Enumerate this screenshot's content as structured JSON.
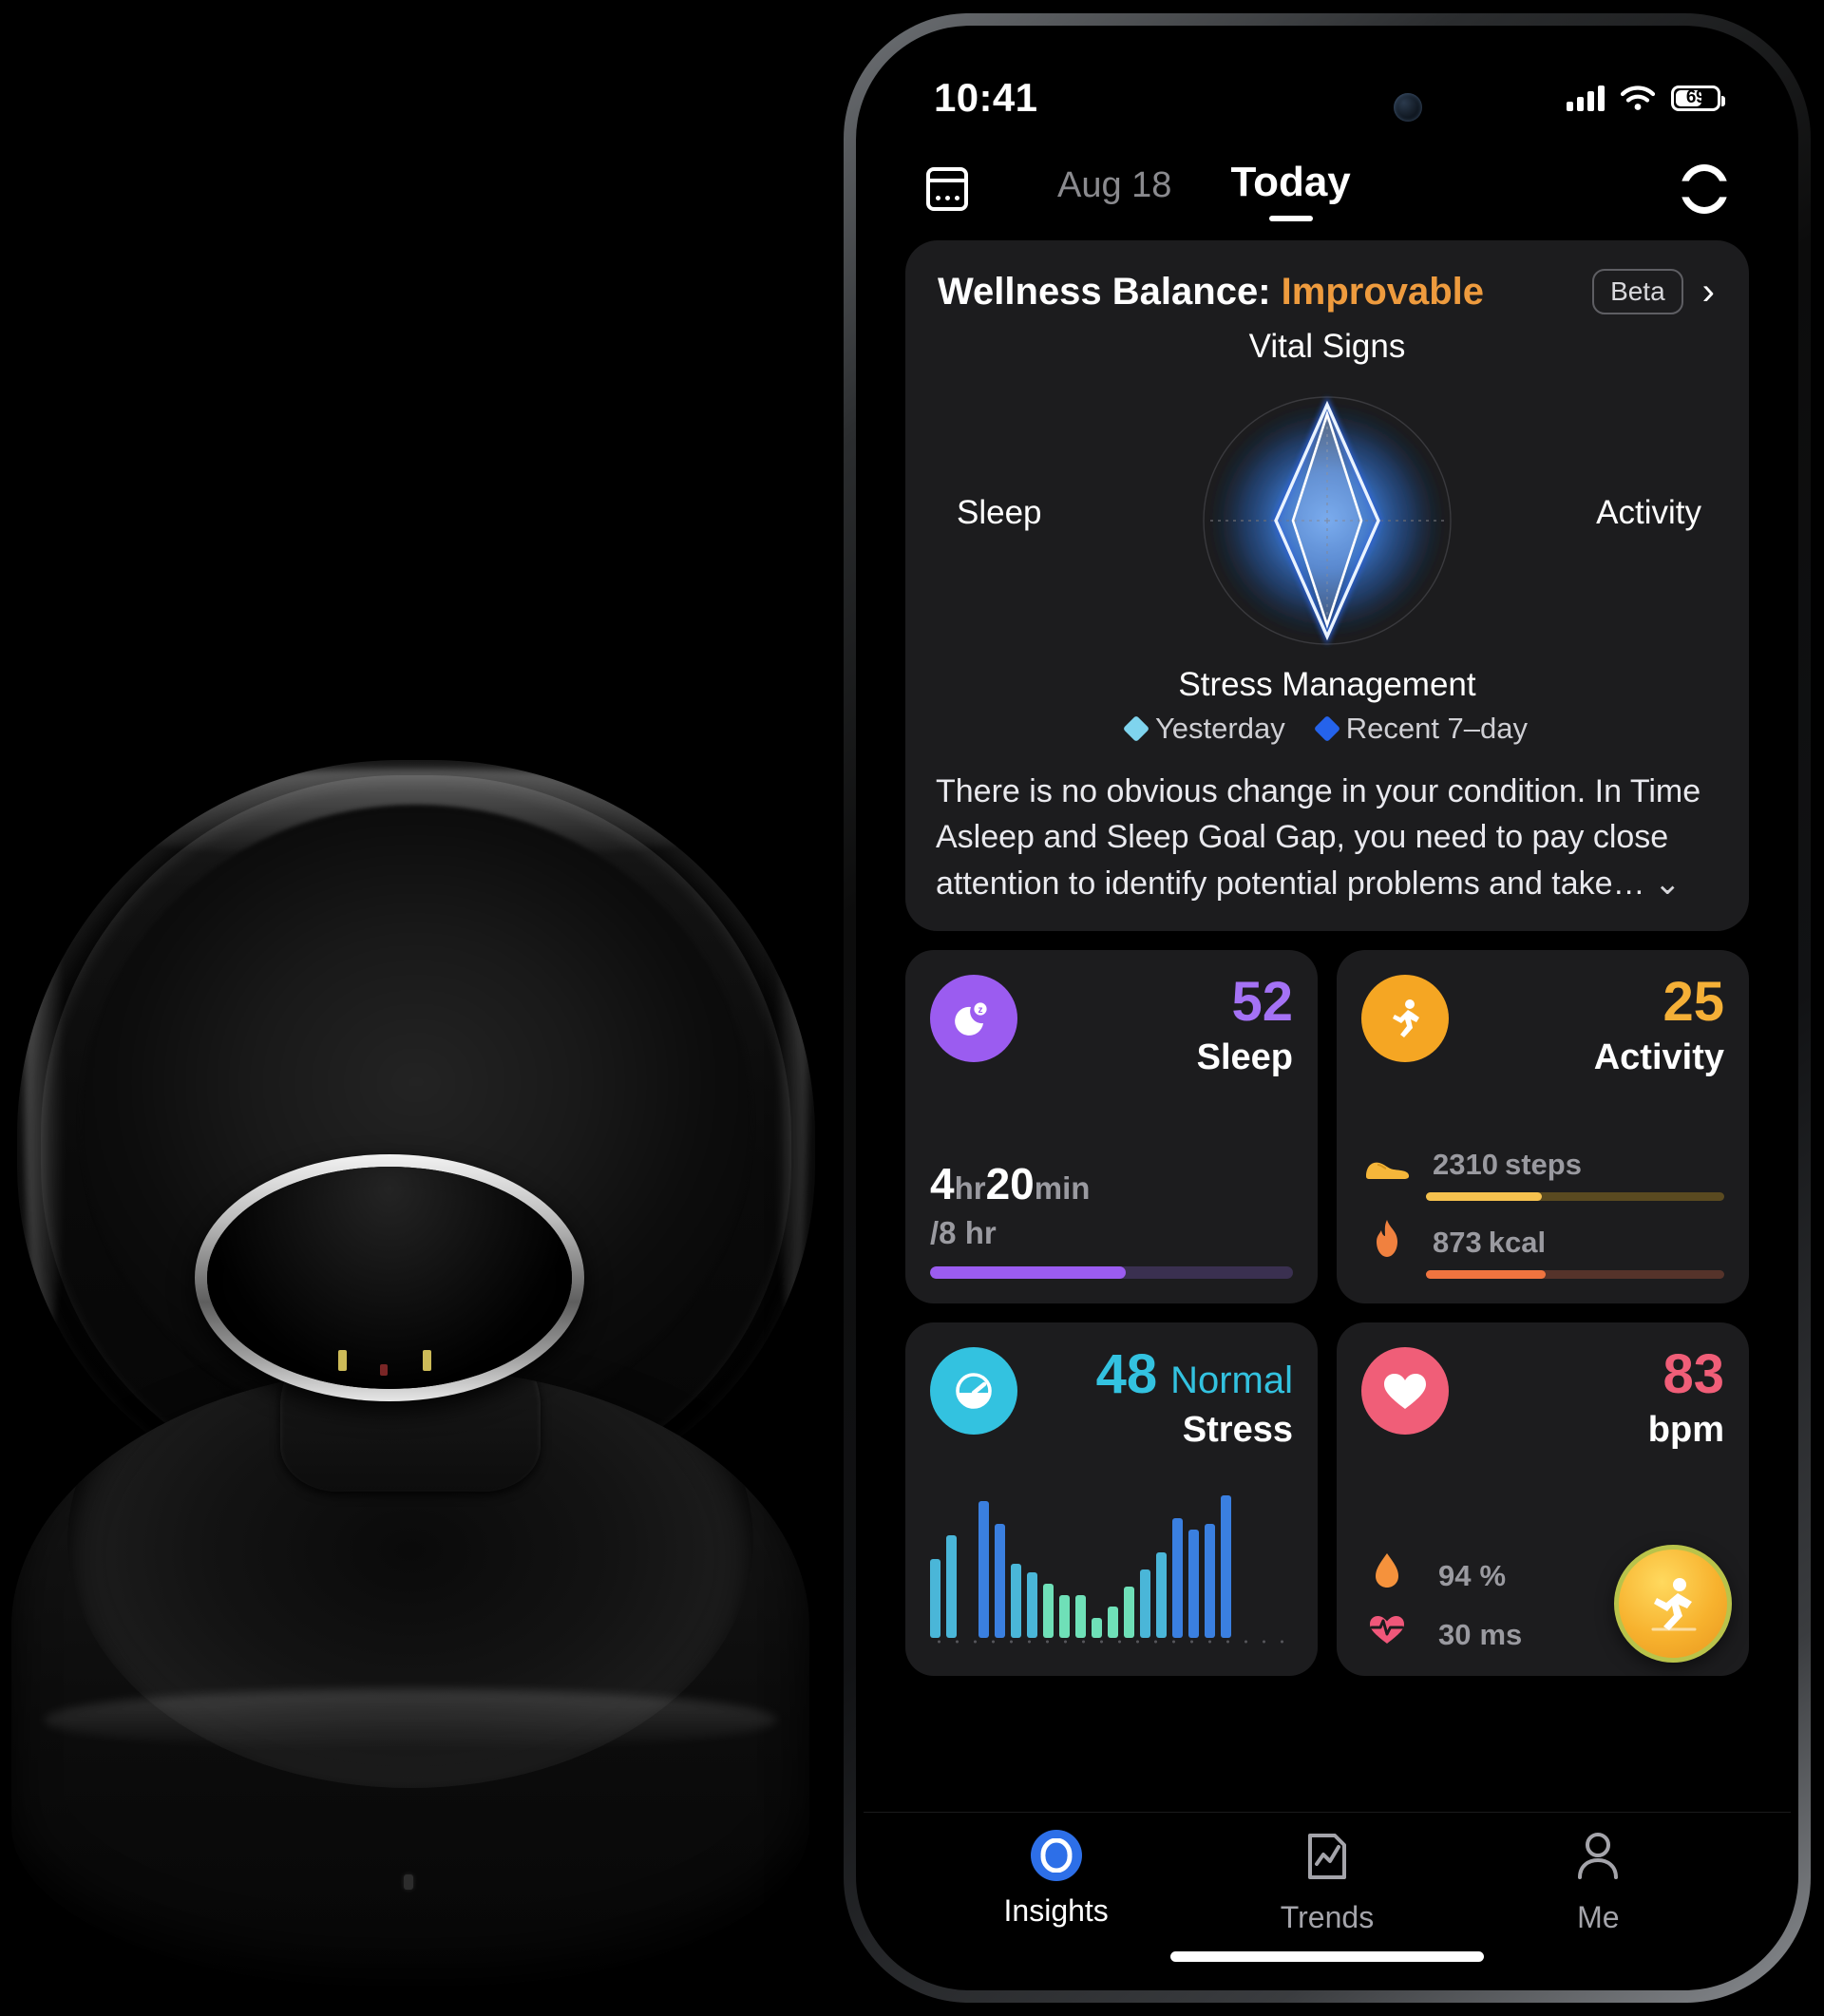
{
  "product": {
    "name": "smart-ring-with-charging-case",
    "description": "Black smart ring resting in its open black charging case"
  },
  "status_bar": {
    "time": "10:41",
    "battery_percent": "69",
    "signal_icon": "cellular-signal-icon",
    "wifi_icon": "wifi-icon",
    "battery_icon": "battery-icon"
  },
  "nav": {
    "calendar_icon": "calendar-icon",
    "previous_date": "Aug 18",
    "current_date": "Today",
    "sync_icon": "sync-ring-icon"
  },
  "wellness": {
    "title_prefix": "Wellness Balance: ",
    "status": "Improvable",
    "status_color": "#ee9b3e",
    "beta_label": "Beta",
    "chevron": "›",
    "description": "There is no obvious change in your condition. In Time Asleep and Sleep Goal Gap, you need to pay close attention to identify potential problems and take…",
    "expand_chevron": "⌄",
    "legend": [
      {
        "label": "Yesterday",
        "color": "#7fd4ee"
      },
      {
        "label": "Recent 7–day",
        "color": "#2563eb"
      }
    ]
  },
  "chart_data": {
    "type": "radar",
    "title": "Wellness Balance",
    "categories": [
      "Vital Signs",
      "Activity",
      "Stress Management",
      "Sleep"
    ],
    "axis_max": 100,
    "grid": true,
    "legend_position": "bottom",
    "series": [
      {
        "name": "Yesterday",
        "color": "#cfe9f7",
        "values": [
          92,
          42,
          88,
          40
        ]
      },
      {
        "name": "Recent 7–day",
        "color": "#2563eb",
        "values": [
          86,
          50,
          82,
          48
        ]
      }
    ]
  },
  "cards": {
    "sleep": {
      "icon": "moon-sleep-icon",
      "icon_color": "#9b5cf0",
      "score": "52",
      "name": "Sleep",
      "duration_hours": "4",
      "hours_unit": "hr",
      "duration_minutes": "20",
      "minutes_unit": "min",
      "goal": "/8 hr",
      "progress_percent": 54
    },
    "activity": {
      "icon": "running-person-icon",
      "icon_color": "#f5a623",
      "score": "25",
      "name": "Activity",
      "metrics": [
        {
          "icon": "shoe-icon",
          "value": "2310",
          "unit": "steps",
          "progress_percent": 39,
          "color": "#f5c14e"
        },
        {
          "icon": "flame-icon",
          "value": "873",
          "unit": "kcal",
          "progress_percent": 40,
          "color": "#f0743f"
        }
      ]
    },
    "stress": {
      "icon": "gauge-icon",
      "icon_color": "#33c2e0",
      "score": "48",
      "status": "Normal",
      "name": "Stress",
      "chart": {
        "type": "bar",
        "values": [
          55,
          72,
          0,
          96,
          80,
          52,
          46,
          38,
          30,
          30,
          14,
          22,
          36,
          48,
          60,
          84,
          76,
          80,
          100
        ],
        "ymax": 100
      }
    },
    "heart": {
      "icon": "heart-icon",
      "icon_color": "#f05e78",
      "score": "83",
      "unit": "bpm",
      "metrics": [
        {
          "icon": "blood-drop-icon",
          "value": "94",
          "unit": "%"
        },
        {
          "icon": "heart-pulse-icon",
          "value": "30",
          "unit": "ms"
        }
      ],
      "fab_icon": "running-workout-icon"
    }
  },
  "tabs": [
    {
      "label": "Insights",
      "icon": "insights-ring-icon",
      "active": true
    },
    {
      "label": "Trends",
      "icon": "trends-chart-icon",
      "active": false
    },
    {
      "label": "Me",
      "icon": "person-icon",
      "active": false
    }
  ]
}
